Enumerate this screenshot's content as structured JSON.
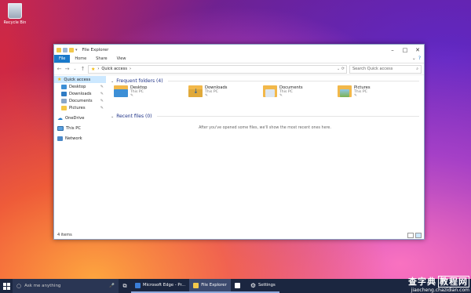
{
  "desktop": {
    "recycle_bin_label": "Recycle Bin"
  },
  "window": {
    "title": "File Explorer",
    "controls": {
      "minimize": "–",
      "maximize": "□",
      "close": "✕"
    },
    "ribbon_tabs": [
      {
        "label": "File"
      },
      {
        "label": "Home"
      },
      {
        "label": "Share"
      },
      {
        "label": "View"
      }
    ],
    "address": {
      "path_root": "›",
      "path_label": "Quick access",
      "path_sep": "›",
      "search_placeholder": "Search Quick access"
    },
    "sidebar": {
      "quick_access": "Quick access",
      "pinned": [
        {
          "label": "Desktop"
        },
        {
          "label": "Downloads"
        },
        {
          "label": "Documents"
        },
        {
          "label": "Pictures"
        }
      ],
      "onedrive": "OneDrive",
      "this_pc": "This PC",
      "network": "Network"
    },
    "frequent": {
      "header": "Frequent folders (4)",
      "items": [
        {
          "name": "Desktop",
          "location": "This PC"
        },
        {
          "name": "Downloads",
          "location": "This PC"
        },
        {
          "name": "Documents",
          "location": "This PC"
        },
        {
          "name": "Pictures",
          "location": "This PC"
        }
      ]
    },
    "recent": {
      "header": "Recent files (0)",
      "empty_message": "After you've opened some files, we'll show the most recent ones here."
    },
    "status": {
      "items": "4 items"
    }
  },
  "taskbar": {
    "search_placeholder": "Ask me anything",
    "apps": [
      {
        "label": "Microsoft Edge - Pr..."
      },
      {
        "label": "File Explorer"
      },
      {
        "label": ""
      },
      {
        "label": "Settings"
      }
    ]
  },
  "watermark": {
    "line1a": "查字典",
    "line1b": "教程网",
    "line2": "jiaocheng.chazidian.com"
  },
  "colors": {
    "accent": "#1979ca",
    "folder": "#f6c846",
    "taskbar": "#1b2640"
  }
}
